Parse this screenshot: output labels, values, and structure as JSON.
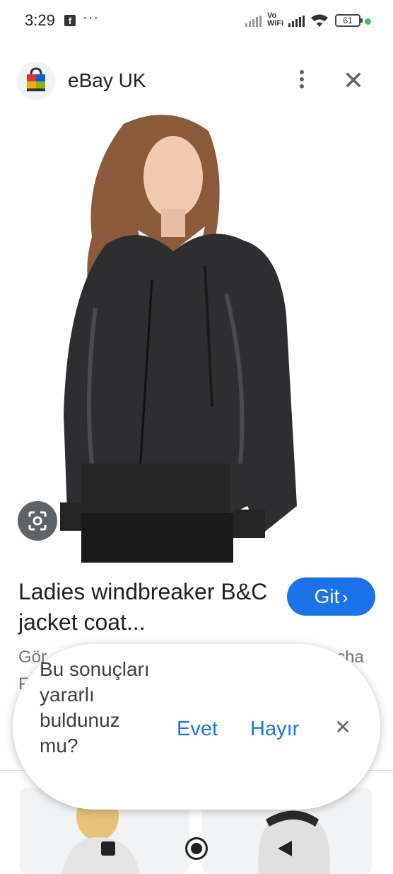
{
  "status_bar": {
    "time": "3:29",
    "notification_icons": [
      "facebook-icon",
      "more-icon"
    ],
    "network_label": "Vo WiFi",
    "network_label_top": "Vo",
    "network_label_bottom": "WiFi",
    "battery_level": "61",
    "indicator_color": "#3ec35a"
  },
  "header": {
    "site_name": "eBay UK",
    "logo_icon": "shopping-bag-icon",
    "menu_icon": "kebab-menu-icon",
    "close_icon": "close-icon"
  },
  "product": {
    "title": "Ladies windbreaker B&C jacket coat...",
    "go_button_label": "Git",
    "go_button_icon": "chevron-right-icon",
    "partial_text_left": "Gör",
    "partial_text_right": "cha",
    "partial_text_line2": "F"
  },
  "feedback": {
    "question": "Bu sonuçları yararlı buldunuz mu?",
    "yes_label": "Evet",
    "no_label": "Hayır",
    "close_icon": "close-icon"
  },
  "colors": {
    "accent": "#1a73e8",
    "text": "#202124",
    "secondary_text": "#70757a"
  }
}
